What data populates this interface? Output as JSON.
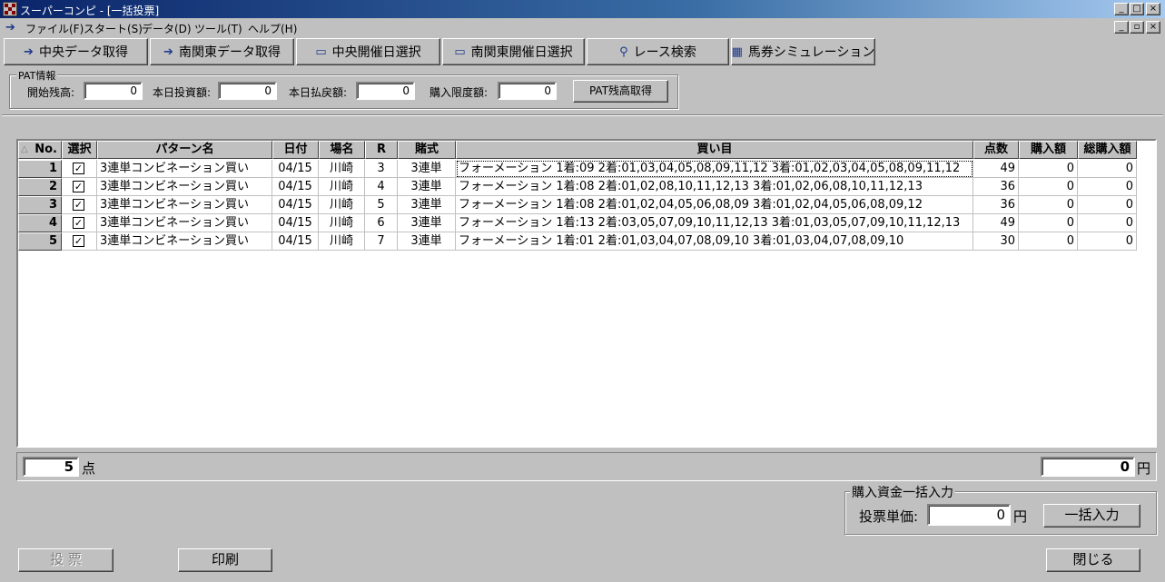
{
  "window": {
    "title": "スーパーコンピ - [一括投票]",
    "controls": [
      "_",
      "□",
      "×"
    ],
    "mdi_controls": [
      "_",
      "▫",
      "×"
    ]
  },
  "menu": [
    "ファイル(F)",
    "スタート(S)",
    "データ(D)",
    "ツール(T)",
    "ヘルプ(H)"
  ],
  "toolbar": [
    {
      "label": "中央データ取得",
      "icon": "arrow-icon"
    },
    {
      "label": "南関東データ取得",
      "icon": "arrow-icon"
    },
    {
      "label": "中央開催日選択",
      "icon": "calendar-icon"
    },
    {
      "label": "南関東開催日選択",
      "icon": "calendar-icon"
    },
    {
      "label": "レース検索",
      "icon": "search-icon"
    },
    {
      "label": "馬券シミュレーション",
      "icon": "table-icon"
    }
  ],
  "pat": {
    "legend": "PAT情報",
    "start_balance_label": "開始残高:",
    "start_balance": "0",
    "today_bet_label": "本日投資額:",
    "today_bet": "0",
    "today_refund_label": "本日払戻額:",
    "today_refund": "0",
    "limit_label": "購入限度額:",
    "limit": "0",
    "fetch_button": "PAT残高取得"
  },
  "grid": {
    "sort_glyph": "△",
    "columns": [
      "No.",
      "選択",
      "パターン名",
      "日付",
      "場名",
      "R",
      "賭式",
      "買い目",
      "点数",
      "購入額",
      "総購入額"
    ],
    "check_glyph": "✓",
    "rows": [
      {
        "no": "1",
        "checked": true,
        "pattern": "3連単コンビネーション買い",
        "date": "04/15",
        "venue": "川崎",
        "race": "3",
        "type": "3連単",
        "bets": "フォーメーション 1着:09 2着:01,03,04,05,08,09,11,12 3着:01,02,03,04,05,08,09,11,12",
        "points": "49",
        "amount": "0",
        "total": "0"
      },
      {
        "no": "2",
        "checked": true,
        "pattern": "3連単コンビネーション買い",
        "date": "04/15",
        "venue": "川崎",
        "race": "4",
        "type": "3連単",
        "bets": "フォーメーション 1着:08 2着:01,02,08,10,11,12,13 3着:01,02,06,08,10,11,12,13",
        "points": "36",
        "amount": "0",
        "total": "0"
      },
      {
        "no": "3",
        "checked": true,
        "pattern": "3連単コンビネーション買い",
        "date": "04/15",
        "venue": "川崎",
        "race": "5",
        "type": "3連単",
        "bets": "フォーメーション 1着:08 2着:01,02,04,05,06,08,09 3着:01,02,04,05,06,08,09,12",
        "points": "36",
        "amount": "0",
        "total": "0"
      },
      {
        "no": "4",
        "checked": true,
        "pattern": "3連単コンビネーション買い",
        "date": "04/15",
        "venue": "川崎",
        "race": "6",
        "type": "3連単",
        "bets": "フォーメーション 1着:13 2着:03,05,07,09,10,11,12,13 3着:01,03,05,07,09,10,11,12,13",
        "points": "49",
        "amount": "0",
        "total": "0"
      },
      {
        "no": "5",
        "checked": true,
        "pattern": "3連単コンビネーション買い",
        "date": "04/15",
        "venue": "川崎",
        "race": "7",
        "type": "3連単",
        "bets": "フォーメーション 1着:01 2着:01,03,04,07,08,09,10 3着:01,03,04,07,08,09,10",
        "points": "30",
        "amount": "0",
        "total": "0"
      }
    ]
  },
  "summary": {
    "count": "5",
    "count_unit": "点",
    "total": "0",
    "total_unit": "円"
  },
  "bulk": {
    "legend": "購入資金一括入力",
    "unit_price_label": "投票単価:",
    "unit_price": "0",
    "unit": "円",
    "apply_button": "一括入力"
  },
  "footer": {
    "vote_button": "投 票",
    "print_button": "印刷",
    "close_button": "閉じる"
  }
}
